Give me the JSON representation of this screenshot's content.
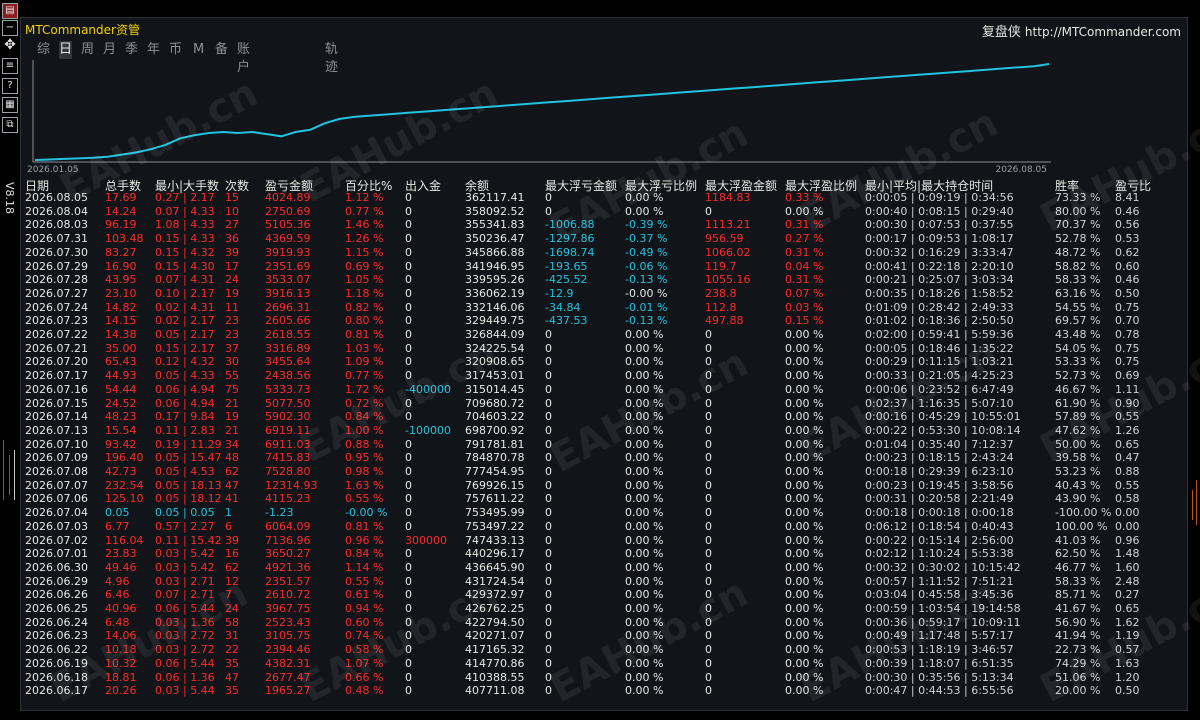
{
  "app_title": "MTCommander资管",
  "brand": "复盘侠",
  "url": "http://MTCommander.com",
  "version": "V8.18",
  "tabs": [
    {
      "label": "综",
      "active": false
    },
    {
      "label": "日",
      "active": true
    },
    {
      "label": "周",
      "active": false
    },
    {
      "label": "月",
      "active": false
    },
    {
      "label": "季",
      "active": false
    },
    {
      "label": "年",
      "active": false
    },
    {
      "label": "币",
      "active": false
    },
    {
      "label": "M",
      "active": false
    },
    {
      "label": "备",
      "active": false
    },
    {
      "label": "账户",
      "active": false
    },
    {
      "label": "轨迹",
      "active": false
    }
  ],
  "side_icons": [
    "chart-icon",
    "minus-icon",
    "move-icon",
    "settings-icon",
    "help-icon",
    "book-icon",
    "window-icon"
  ],
  "colors": {
    "line": "#21c3e0",
    "negative": "#ff2a2a",
    "positive": "#21c3e0",
    "title": "#f2d000"
  },
  "watermark": "EAHub.cn",
  "chart_data": {
    "type": "line",
    "x_start_label": "2026.01.05",
    "x_end_label": "2026.08.05",
    "series": [
      {
        "values": [
          10,
          10.5,
          11,
          11.5,
          12,
          13,
          15,
          17,
          20,
          24,
          30,
          33,
          35,
          36,
          35,
          36,
          34,
          32,
          36,
          38,
          44,
          48,
          50,
          51,
          52,
          53,
          54,
          55,
          56,
          57,
          58,
          59,
          60,
          61,
          62,
          63,
          64,
          65,
          66,
          67,
          68,
          69,
          70,
          71,
          72,
          73,
          74,
          75,
          76,
          77,
          78,
          79,
          80,
          81,
          82,
          83,
          84,
          85,
          86,
          87,
          88,
          89,
          90,
          91,
          92,
          93,
          94,
          95,
          96,
          97,
          99
        ]
      }
    ]
  },
  "table": {
    "headers": [
      "日期",
      "总手数",
      "最小|大手数",
      "次数",
      "盈亏金额",
      "百分比%",
      "出入金",
      "余额",
      "最大浮亏金额",
      "最大浮亏比例",
      "最大浮盈金额",
      "最大浮盈比例",
      "最小|平均|最大持仓时间",
      "胜率",
      "盈亏比"
    ],
    "rows": [
      [
        "2026.08.05",
        "17.69",
        "0.27 | 2.17",
        "15",
        "4024.89",
        "1.12 %",
        "0",
        "362117.41",
        "0",
        "0.00 %",
        "1184.83",
        "0.33 %",
        "0:00:05 | 0:09:19 | 0:34:56",
        "73.33 %",
        "8.41"
      ],
      [
        "2026.08.04",
        "14.24",
        "0.07 | 4.33",
        "10",
        "2750.69",
        "0.77 %",
        "0",
        "358092.52",
        "0",
        "0.00 %",
        "0",
        "0.00 %",
        "0:00:40 | 0:08:15 | 0:29:40",
        "80.00 %",
        "0.46"
      ],
      [
        "2026.08.03",
        "96.19",
        "1.08 | 4.33",
        "27",
        "5105.36",
        "1.46 %",
        "0",
        "355341.83",
        "-1006.88",
        "-0.39 %",
        "1113.21",
        "0.31 %",
        "0:00:30 | 0:07:53 | 0:37:55",
        "70.37 %",
        "0.56"
      ],
      [
        "2026.07.31",
        "103.48",
        "0.15 | 4.33",
        "36",
        "4369.59",
        "1.26 %",
        "0",
        "350236.47",
        "-1297.86",
        "-0.37 %",
        "956.59",
        "0.27 %",
        "0:00:17 | 0:09:53 | 1:08:17",
        "52.78 %",
        "0.53"
      ],
      [
        "2026.07.30",
        "83.27",
        "0.15 | 4.32",
        "39",
        "3919.93",
        "1.15 %",
        "0",
        "345866.88",
        "-1698.74",
        "-0.49 %",
        "1066.02",
        "0.31 %",
        "0:00:32 | 0:16:29 | 3:33:47",
        "48.72 %",
        "0.62"
      ],
      [
        "2026.07.29",
        "16.90",
        "0.15 | 4.30",
        "17",
        "2351.69",
        "0.69 %",
        "0",
        "341946.95",
        "-193.65",
        "-0.06 %",
        "119.7",
        "0.04 %",
        "0:00:41 | 0:22:18 | 2:20:10",
        "58.82 %",
        "0.60"
      ],
      [
        "2026.07.28",
        "43.95",
        "0.07 | 4.31",
        "24",
        "3533.07",
        "1.05 %",
        "0",
        "339595.26",
        "-425.52",
        "-0.13 %",
        "1055.16",
        "0.31 %",
        "0:00:21 | 0:25:07 | 3:03:34",
        "58.33 %",
        "0.46"
      ],
      [
        "2026.07.27",
        "23.10",
        "0.10 | 2.17",
        "19",
        "3916.13",
        "1.18 %",
        "0",
        "336062.19",
        "-12.9",
        "-0.00 %",
        "238.8",
        "0.07 %",
        "0:00:35 | 0:18:26 | 1:58:52",
        "63.16 %",
        "0.50"
      ],
      [
        "2026.07.24",
        "14.82",
        "0.02 | 4.31",
        "11",
        "2696.31",
        "0.82 %",
        "0",
        "332146.06",
        "-34.84",
        "-0.01 %",
        "112.8",
        "0.03 %",
        "0:01:09 | 0:28:42 | 2:49:33",
        "54.55 %",
        "0.75"
      ],
      [
        "2026.07.23",
        "14.15",
        "0.02 | 2.17",
        "23",
        "2605.66",
        "0.80 %",
        "0",
        "329449.75",
        "-437.53",
        "-0.13 %",
        "497.88",
        "0.15 %",
        "0:01:02 | 0:18:36 | 2:50:50",
        "69.57 %",
        "0.70"
      ],
      [
        "2026.07.22",
        "14.38",
        "0.05 | 2.17",
        "23",
        "2618.55",
        "0.81 %",
        "0",
        "326844.09",
        "0",
        "0.00 %",
        "0",
        "0.00 %",
        "0:02:00 | 0:59:41 | 5:59:36",
        "43.48 %",
        "0.78"
      ],
      [
        "2026.07.21",
        "35.00",
        "0.15 | 2.17",
        "37",
        "3316.89",
        "1.03 %",
        "0",
        "324225.54",
        "0",
        "0.00 %",
        "0",
        "0.00 %",
        "0:00:05 | 0:18:46 | 1:35:22",
        "54.05 %",
        "0.75"
      ],
      [
        "2026.07.20",
        "65.43",
        "0.12 | 4.32",
        "30",
        "3455.64",
        "1.09 %",
        "0",
        "320908.65",
        "0",
        "0.00 %",
        "0",
        "0.00 %",
        "0:00:29 | 0:11:15 | 1:03:21",
        "53.33 %",
        "0.75"
      ],
      [
        "2026.07.17",
        "44.93",
        "0.05 | 4.33",
        "55",
        "2438.56",
        "0.77 %",
        "0",
        "317453.01",
        "0",
        "0.00 %",
        "0",
        "0.00 %",
        "0:00:33 | 0:21:05 | 4:25:23",
        "52.73 %",
        "0.69"
      ],
      [
        "2026.07.16",
        "54.44",
        "0.06 | 4.94",
        "75",
        "5333.73",
        "1.72 %",
        "-400000",
        "315014.45",
        "0",
        "0.00 %",
        "0",
        "0.00 %",
        "0:00:06 | 0:23:52 | 6:47:49",
        "46.67 %",
        "1.11"
      ],
      [
        "2026.07.15",
        "24.52",
        "0.06 | 4.94",
        "21",
        "5077.50",
        "0.72 %",
        "0",
        "709680.72",
        "0",
        "0.00 %",
        "0",
        "0.00 %",
        "0:02:37 | 1:16:35 | 5:07:10",
        "61.90 %",
        "0.90"
      ],
      [
        "2026.07.14",
        "48.23",
        "0.17 | 9.84",
        "19",
        "5902.30",
        "0.84 %",
        "0",
        "704603.22",
        "0",
        "0.00 %",
        "0",
        "0.00 %",
        "0:00:16 | 0:45:29 | 10:55:01",
        "57.89 %",
        "0.55"
      ],
      [
        "2026.07.13",
        "15.54",
        "0.11 | 2.83",
        "21",
        "6919.11",
        "1.00 %",
        "-100000",
        "698700.92",
        "0",
        "0.00 %",
        "0",
        "0.00 %",
        "0:00:22 | 0:53:30 | 10:08:14",
        "47.62 %",
        "1.26"
      ],
      [
        "2026.07.10",
        "93.42",
        "0.19 | 11.29",
        "34",
        "6911.03",
        "0.88 %",
        "0",
        "791781.81",
        "0",
        "0.00 %",
        "0",
        "0.00 %",
        "0:01:04 | 0:35:40 | 7:12:37",
        "50.00 %",
        "0.65"
      ],
      [
        "2026.07.09",
        "196.40",
        "0.05 | 15.47",
        "48",
        "7415.83",
        "0.95 %",
        "0",
        "784870.78",
        "0",
        "0.00 %",
        "0",
        "0.00 %",
        "0:00:23 | 0:18:15 | 2:43:24",
        "39.58 %",
        "0.47"
      ],
      [
        "2026.07.08",
        "42.73",
        "0.05 | 4.53",
        "62",
        "7528.80",
        "0.98 %",
        "0",
        "777454.95",
        "0",
        "0.00 %",
        "0",
        "0.00 %",
        "0:00:18 | 0:29:39 | 6:23:10",
        "53.23 %",
        "0.88"
      ],
      [
        "2026.07.07",
        "232.54",
        "0.05 | 18.13",
        "47",
        "12314.93",
        "1.63 %",
        "0",
        "769926.15",
        "0",
        "0.00 %",
        "0",
        "0.00 %",
        "0:00:23 | 0:19:45 | 3:58:56",
        "40.43 %",
        "0.55"
      ],
      [
        "2026.07.06",
        "125.10",
        "0.05 | 18.12",
        "41",
        "4115.23",
        "0.55 %",
        "0",
        "757611.22",
        "0",
        "0.00 %",
        "0",
        "0.00 %",
        "0:00:31 | 0:20:58 | 2:21:49",
        "43.90 %",
        "0.58"
      ],
      [
        "2026.07.04",
        "0.05",
        "0.05 | 0.05",
        "1",
        "-1.23",
        "-0.00 %",
        "0",
        "753495.99",
        "0",
        "0.00 %",
        "0",
        "0.00 %",
        "0:00:18 | 0:00:18 | 0:00:18",
        "-100.00 %",
        "0.00"
      ],
      [
        "2026.07.03",
        "6.77",
        "0.57 | 2.27",
        "6",
        "6064.09",
        "0.81 %",
        "0",
        "753497.22",
        "0",
        "0.00 %",
        "0",
        "0.00 %",
        "0:06:12 | 0:18:54 | 0:40:43",
        "100.00 %",
        "0.00"
      ],
      [
        "2026.07.02",
        "116.04",
        "0.11 | 15.42",
        "39",
        "7136.96",
        "0.96 %",
        "300000",
        "747433.13",
        "0",
        "0.00 %",
        "0",
        "0.00 %",
        "0:00:22 | 0:15:14 | 2:56:00",
        "41.03 %",
        "0.96"
      ],
      [
        "2026.07.01",
        "23.83",
        "0.03 | 5.42",
        "16",
        "3650.27",
        "0.84 %",
        "0",
        "440296.17",
        "0",
        "0.00 %",
        "0",
        "0.00 %",
        "0:02:12 | 1:10:24 | 5:53:38",
        "62.50 %",
        "1.48"
      ],
      [
        "2026.06.30",
        "49.46",
        "0.03 | 5.42",
        "62",
        "4921.36",
        "1.14 %",
        "0",
        "436645.90",
        "0",
        "0.00 %",
        "0",
        "0.00 %",
        "0:00:32 | 0:30:02 | 10:15:42",
        "46.77 %",
        "1.60"
      ],
      [
        "2026.06.29",
        "4.96",
        "0.03 | 2.71",
        "12",
        "2351.57",
        "0.55 %",
        "0",
        "431724.54",
        "0",
        "0.00 %",
        "0",
        "0.00 %",
        "0:00:57 | 1:11:52 | 7:51:21",
        "58.33 %",
        "2.48"
      ],
      [
        "2026.06.26",
        "6.46",
        "0.07 | 2.71",
        "7",
        "2610.72",
        "0.61 %",
        "0",
        "429372.97",
        "0",
        "0.00 %",
        "0",
        "0.00 %",
        "0:03:04 | 0:45:58 | 3:45:36",
        "85.71 %",
        "0.27"
      ],
      [
        "2026.06.25",
        "40.96",
        "0.06 | 5.44",
        "24",
        "3967.75",
        "0.94 %",
        "0",
        "426762.25",
        "0",
        "0.00 %",
        "0",
        "0.00 %",
        "0:00:59 | 1:03:54 | 19:14:58",
        "41.67 %",
        "0.65"
      ],
      [
        "2026.06.24",
        "6.48",
        "0.03 | 1.36",
        "58",
        "2523.43",
        "0.60 %",
        "0",
        "422794.50",
        "0",
        "0.00 %",
        "0",
        "0.00 %",
        "0:00:36 | 0:59:17 | 10:09:11",
        "56.90 %",
        "1.62"
      ],
      [
        "2026.06.23",
        "14.06",
        "0.03 | 2.72",
        "31",
        "3105.75",
        "0.74 %",
        "0",
        "420271.07",
        "0",
        "0.00 %",
        "0",
        "0.00 %",
        "0:00:49 | 1:17:48 | 5:57:17",
        "41.94 %",
        "1.19"
      ],
      [
        "2026.06.22",
        "10.18",
        "0.03 | 2.72",
        "22",
        "2394.46",
        "0.58 %",
        "0",
        "417165.32",
        "0",
        "0.00 %",
        "0",
        "0.00 %",
        "0:00:53 | 1:18:19 | 3:46:57",
        "22.73 %",
        "0.57"
      ],
      [
        "2026.06.19",
        "10.32",
        "0.06 | 5.44",
        "35",
        "4382.31",
        "1.07 %",
        "0",
        "414770.86",
        "0",
        "0.00 %",
        "0",
        "0.00 %",
        "0:00:39 | 1:18:07 | 6:51:35",
        "74.29 %",
        "1.63"
      ],
      [
        "2026.06.18",
        "18.81",
        "0.06 | 1.36",
        "47",
        "2677.47",
        "0.66 %",
        "0",
        "410388.55",
        "0",
        "0.00 %",
        "0",
        "0.00 %",
        "0:00:30 | 0:35:56 | 5:13:34",
        "51.06 %",
        "1.20"
      ],
      [
        "2026.06.17",
        "20.26",
        "0.03 | 5.44",
        "35",
        "1965.27",
        "0.48 %",
        "0",
        "407711.08",
        "0",
        "0.00 %",
        "0",
        "0.00 %",
        "0:00:47 | 0:44:53 | 6:55:56",
        "20.00 %",
        "0.50"
      ]
    ]
  }
}
